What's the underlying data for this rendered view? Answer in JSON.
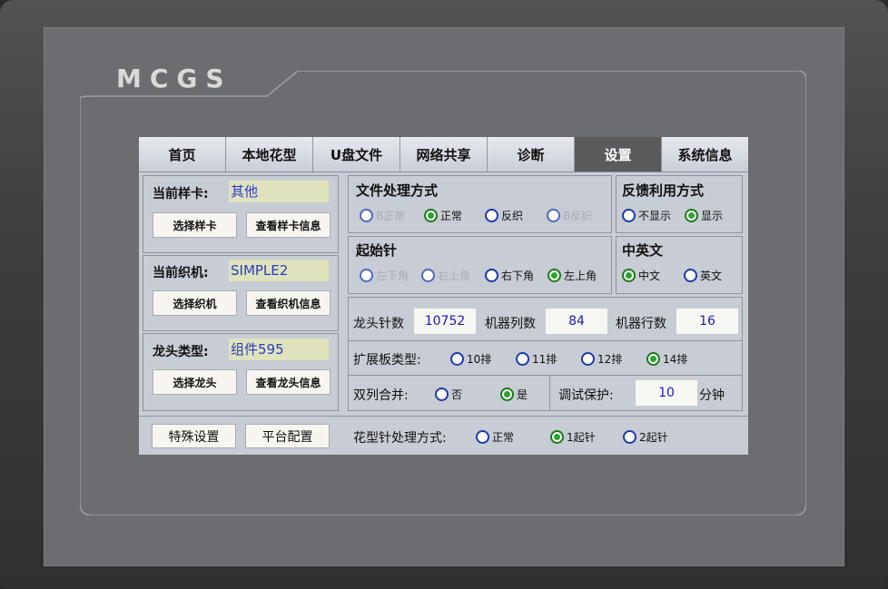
{
  "brand": "MCGS",
  "tabs": [
    {
      "label": "首页",
      "active": false
    },
    {
      "label": "本地花型",
      "active": false
    },
    {
      "label": "U盘文件",
      "active": false
    },
    {
      "label": "网络共享",
      "active": false
    },
    {
      "label": "诊断",
      "active": false
    },
    {
      "label": "设置",
      "active": true
    },
    {
      "label": "系统信息",
      "active": false
    }
  ],
  "left": {
    "card": {
      "label": "当前样卡:",
      "value": "其他",
      "btn_select": "选择样卡",
      "btn_view": "查看样卡信息"
    },
    "machine": {
      "label": "当前织机:",
      "value": "SIMPLE2",
      "btn_select": "选择织机",
      "btn_view": "查看织机信息"
    },
    "head": {
      "label": "龙头类型:",
      "value": "组件595",
      "btn_select": "选择龙头",
      "btn_view": "查看龙头信息"
    }
  },
  "file_mode": {
    "title": "文件处理方式",
    "options": [
      {
        "label": "B正常",
        "selected": false,
        "disabled": true
      },
      {
        "label": "正常",
        "selected": true,
        "disabled": false
      },
      {
        "label": "反织",
        "selected": false,
        "disabled": false
      },
      {
        "label": "B反织",
        "selected": false,
        "disabled": true
      }
    ]
  },
  "feedback": {
    "title": "反馈利用方式",
    "options": [
      {
        "label": "不显示",
        "selected": false
      },
      {
        "label": "显示",
        "selected": true
      }
    ]
  },
  "start_needle": {
    "title": "起始针",
    "options": [
      {
        "label": "左下角",
        "selected": false,
        "disabled": true
      },
      {
        "label": "右上角",
        "selected": false,
        "disabled": true
      },
      {
        "label": "右下角",
        "selected": false,
        "disabled": false
      },
      {
        "label": "左上角",
        "selected": true,
        "disabled": false
      }
    ]
  },
  "language": {
    "title": "中英文",
    "options": [
      {
        "label": "中文",
        "selected": true
      },
      {
        "label": "英文",
        "selected": false
      }
    ]
  },
  "params": {
    "hook_count_label": "龙头针数",
    "hook_count": "10752",
    "machine_cols_label": "机器列数",
    "machine_cols": "84",
    "machine_rows_label": "机器行数",
    "machine_rows": "16"
  },
  "expansion": {
    "label": "扩展板类型:",
    "options": [
      {
        "label": "10排",
        "selected": false
      },
      {
        "label": "11排",
        "selected": false
      },
      {
        "label": "12排",
        "selected": false
      },
      {
        "label": "14排",
        "selected": true
      }
    ]
  },
  "double_merge": {
    "label": "双列合并:",
    "options": [
      {
        "label": "否",
        "selected": false
      },
      {
        "label": "是",
        "selected": true
      }
    ]
  },
  "debug_protect": {
    "label": "调试保护:",
    "value": "10",
    "unit": "分钟"
  },
  "bottom": {
    "special_btn": "特殊设置",
    "platform_btn": "平台配置",
    "needle_mode_label": "花型针处理方式:",
    "options": [
      {
        "label": "正常",
        "selected": false
      },
      {
        "label": "1起针",
        "selected": true
      },
      {
        "label": "2起针",
        "selected": false
      }
    ]
  }
}
